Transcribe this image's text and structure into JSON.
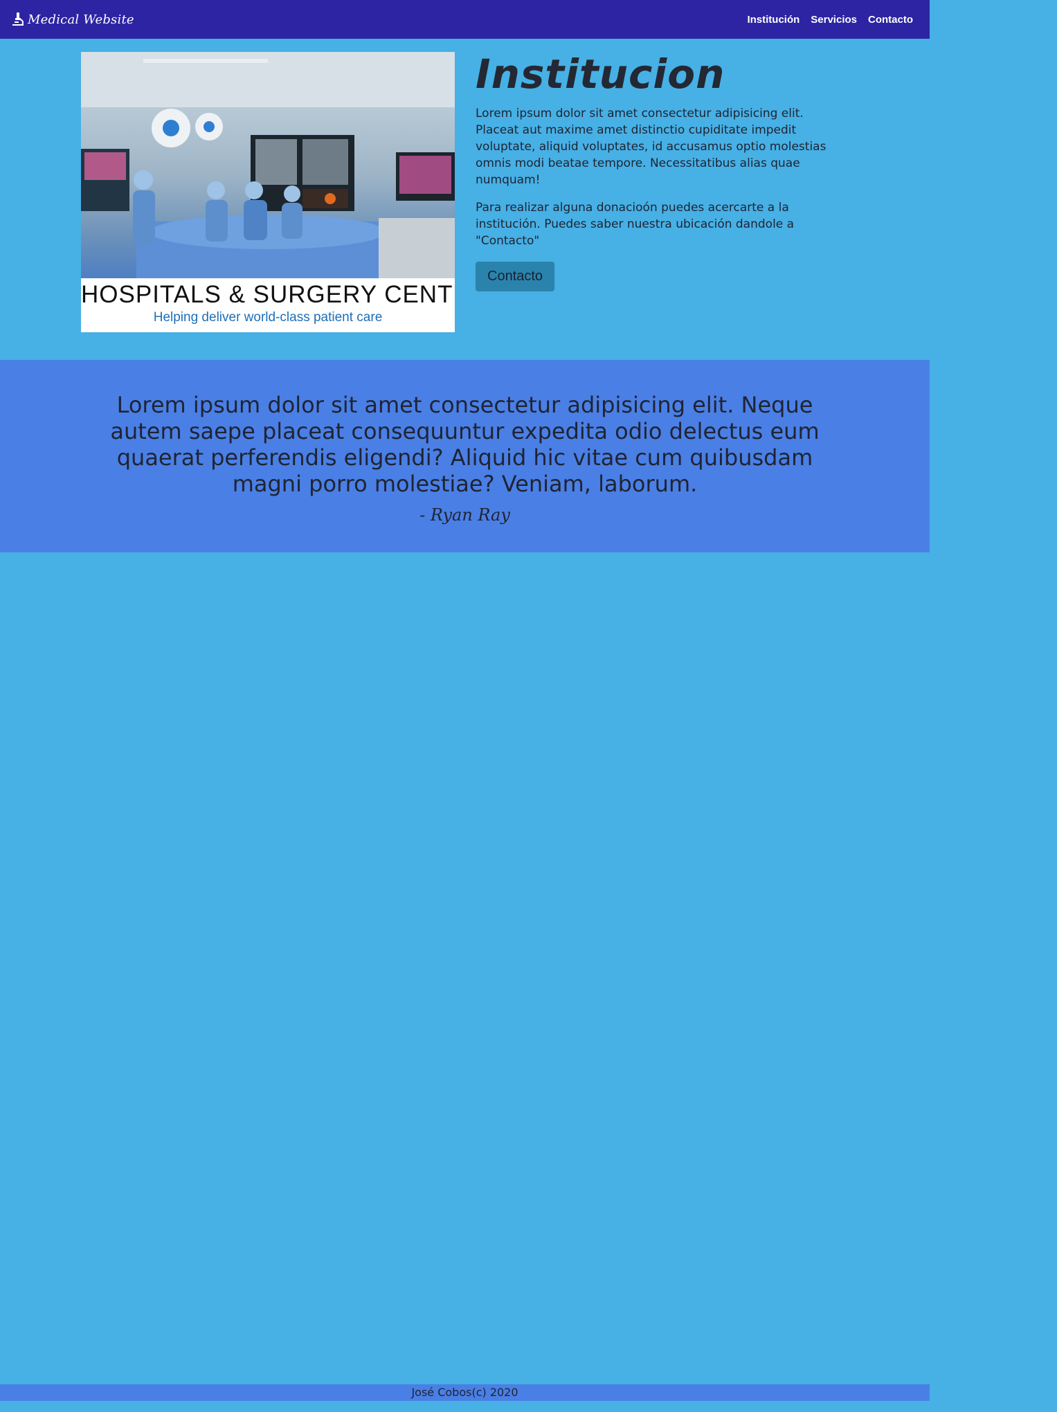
{
  "navbar": {
    "brand_label": "Medical Website",
    "brand_icon": "microscope-icon",
    "links": [
      "Institución",
      "Servicios",
      "Contacto"
    ]
  },
  "hero_image": {
    "caption_main": "HOSPITALS & SURGERY CENTER",
    "caption_sub": "Helping deliver world-class patient care"
  },
  "info": {
    "title": "Institucion",
    "paragraph_1": "Lorem ipsum dolor sit amet consectetur adipisicing elit. Placeat aut maxime amet distinctio cupiditate impedit voluptate, aliquid voluptates, id accusamus optio molestias omnis modi beatae tempore. Necessitatibus alias quae numquam!",
    "paragraph_2": "Para realizar alguna donacioón puedes acercarte a la institución. Puedes saber nuestra ubicación dandole a \"Contacto\"",
    "button_label": "Contacto"
  },
  "quote": {
    "text": "Lorem ipsum dolor sit amet consectetur adipisicing elit. Neque autem saepe placeat consequuntur expedita odio delectus eum quaerat perferendis eligendi? Aliquid hic vitae cum quibusdam magni porro molestiae? Veniam, laborum.",
    "author": "- Ryan Ray"
  },
  "footer": {
    "text": "José Cobos(c) 2020"
  },
  "colors": {
    "page_background": "#47b0e5",
    "navbar_background": "#2d24a3",
    "band_background": "#4a7fe5",
    "button_background": "#2a83ad"
  }
}
